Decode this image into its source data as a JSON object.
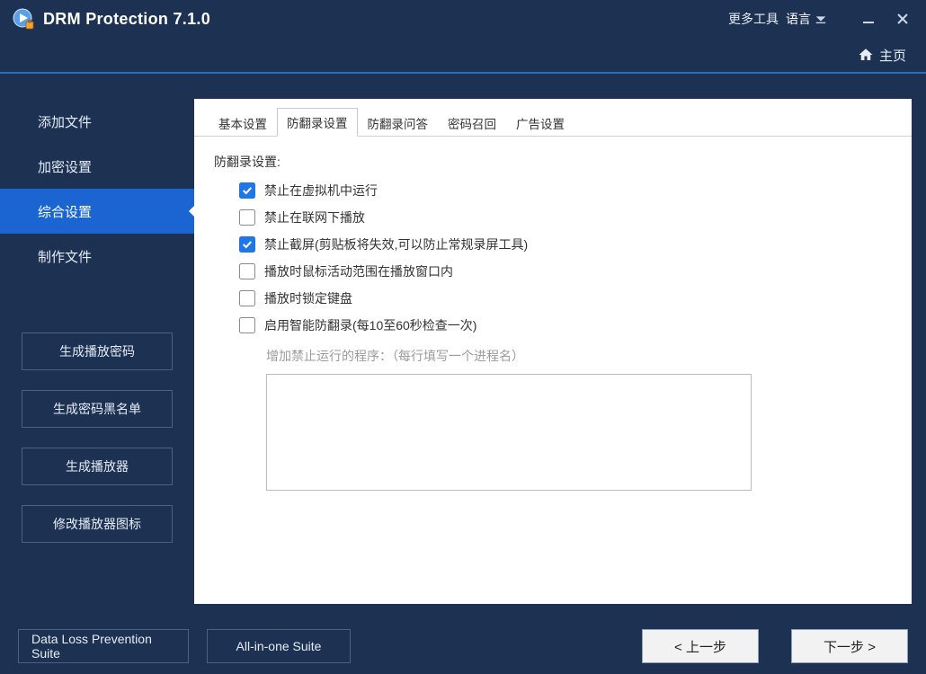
{
  "titlebar": {
    "app_title": "DRM Protection 7.1.0",
    "more_tools": "更多工具",
    "language": "语言"
  },
  "homebar": {
    "home": "主页"
  },
  "sidebar": {
    "nav": [
      {
        "label": "添加文件"
      },
      {
        "label": "加密设置"
      },
      {
        "label": "综合设置"
      },
      {
        "label": "制作文件"
      }
    ],
    "buttons": {
      "gen_play_password": "生成播放密码",
      "gen_password_blacklist": "生成密码黑名单",
      "gen_player": "生成播放器",
      "modify_player_icon": "修改播放器图标"
    }
  },
  "tabs": [
    {
      "label": "基本设置"
    },
    {
      "label": "防翻录设置"
    },
    {
      "label": "防翻录问答"
    },
    {
      "label": "密码召回"
    },
    {
      "label": "广告设置"
    }
  ],
  "anti_record": {
    "section_title": "防翻录设置:",
    "items": [
      {
        "label": "禁止在虚拟机中运行",
        "checked": true
      },
      {
        "label": "禁止在联网下播放",
        "checked": false
      },
      {
        "label": "禁止截屏(剪贴板将失效,可以防止常规录屏工具)",
        "checked": true
      },
      {
        "label": "播放时鼠标活动范围在播放窗口内",
        "checked": false
      },
      {
        "label": "播放时锁定键盘",
        "checked": false
      },
      {
        "label": "启用智能防翻录(每10至60秒检查一次)",
        "checked": false
      }
    ],
    "blocked_hint": "增加禁止运行的程序：（每行填写一个进程名）",
    "blocked_processes": ""
  },
  "footer": {
    "dlp_suite": "Data Loss Prevention Suite",
    "all_in_one": "All-in-one Suite",
    "prev": "< 上一步",
    "next": "下一步 >"
  }
}
